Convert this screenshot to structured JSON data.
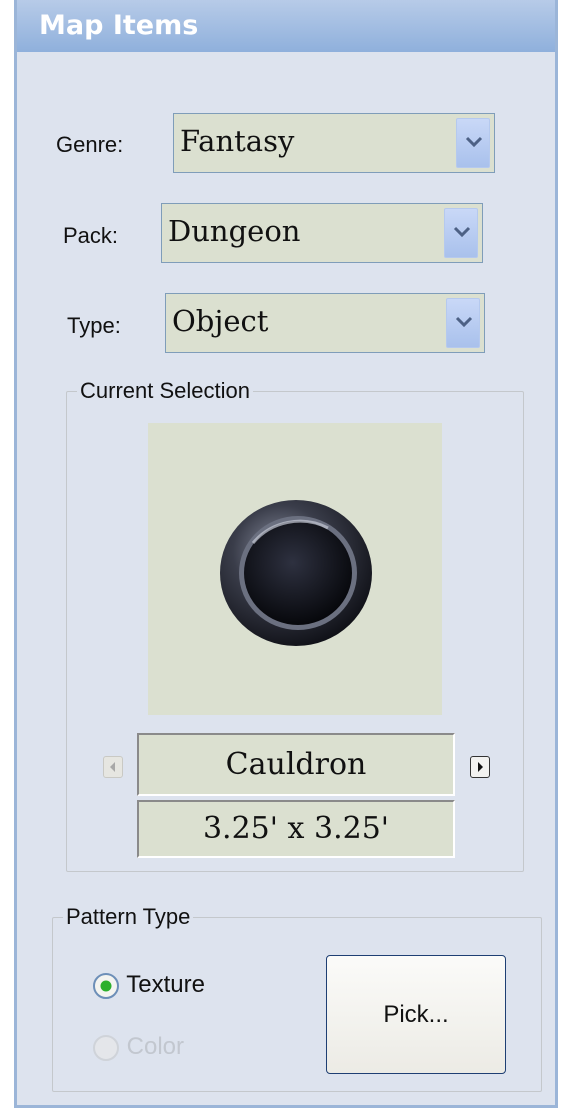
{
  "panel": {
    "title": "Map Items"
  },
  "fields": {
    "genre": {
      "label": "Genre:",
      "value": "Fantasy"
    },
    "pack": {
      "label": "Pack:",
      "value": "Dungeon"
    },
    "type": {
      "label": "Type:",
      "value": "Object"
    }
  },
  "current_selection": {
    "legend": "Current Selection",
    "item_name": "Cauldron",
    "item_size": "3.25' x 3.25'"
  },
  "pattern_type": {
    "legend": "Pattern Type",
    "options": [
      {
        "label": "Texture",
        "selected": true,
        "enabled": true
      },
      {
        "label": "Color",
        "selected": false,
        "enabled": false
      }
    ],
    "pick_button": "Pick..."
  }
}
